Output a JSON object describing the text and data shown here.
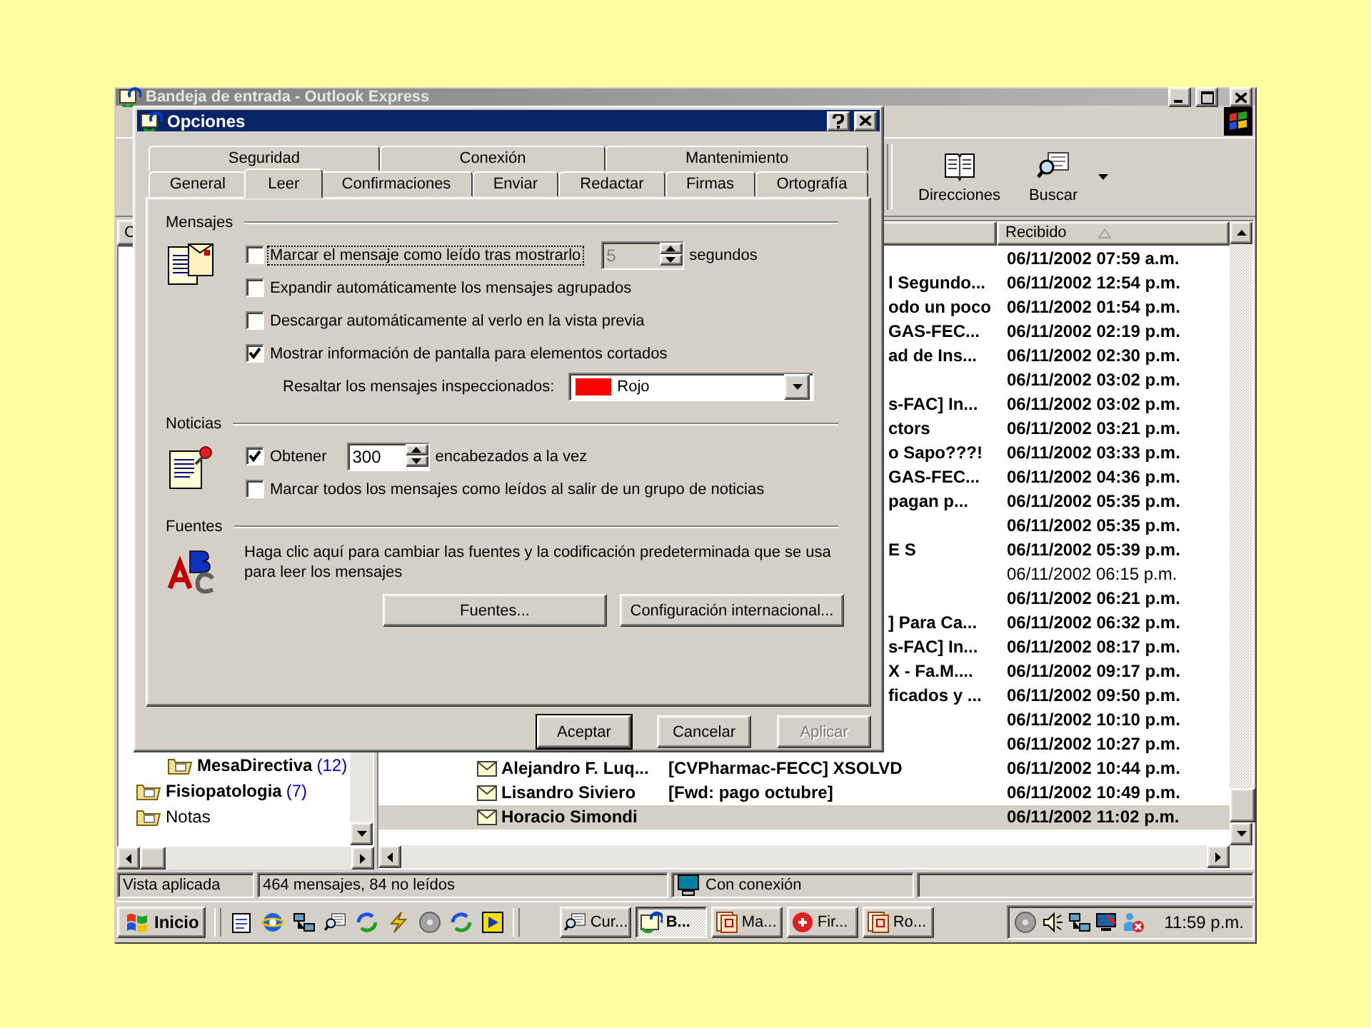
{
  "main_window": {
    "title": "Bandeja de entrada - Outlook Express",
    "toolbar": [
      {
        "label": "Direcciones",
        "kind": "book"
      },
      {
        "label": "Buscar",
        "kind": "search"
      }
    ],
    "folder_pane": {
      "header": "C",
      "folders": [
        {
          "name": "MesaDirectiva",
          "count": "(12)",
          "unread": true,
          "kind": "subfolder"
        },
        {
          "name": "Fisiopatologia",
          "count": "(7)",
          "unread": true,
          "kind": "folder"
        },
        {
          "name": "Notas",
          "unread": false,
          "kind": "folder"
        }
      ]
    },
    "message_list": {
      "columns": [
        {
          "label": "Recibido",
          "sorted": true
        }
      ],
      "rows": [
        {
          "received": "06/11/2002 07:59 a.m.",
          "unread": true,
          "selected": false
        },
        {
          "subject": "l Segundo...",
          "received": "06/11/2002 12:54 p.m.",
          "unread": true,
          "selected": false
        },
        {
          "subject": "odo un poco",
          "received": "06/11/2002 01:54 p.m.",
          "unread": true,
          "selected": false
        },
        {
          "subject": "GAS-FEC...",
          "received": "06/11/2002 02:19 p.m.",
          "unread": true,
          "selected": false
        },
        {
          "subject": "ad de Ins...",
          "received": "06/11/2002 02:30 p.m.",
          "unread": true,
          "selected": false
        },
        {
          "received": "06/11/2002 03:02 p.m.",
          "unread": true,
          "selected": false
        },
        {
          "subject": "s-FAC] In...",
          "received": "06/11/2002 03:02 p.m.",
          "unread": true,
          "selected": false
        },
        {
          "subject": "ctors",
          "received": "06/11/2002 03:21 p.m.",
          "unread": true,
          "selected": false
        },
        {
          "subject": "o Sapo???!",
          "received": "06/11/2002 03:33 p.m.",
          "unread": true,
          "selected": false
        },
        {
          "subject": "GAS-FEC...",
          "received": "06/11/2002 04:36 p.m.",
          "unread": true,
          "selected": false
        },
        {
          "subject": "pagan p...",
          "received": "06/11/2002 05:35 p.m.",
          "unread": true,
          "selected": false
        },
        {
          "received": "06/11/2002 05:35 p.m.",
          "unread": true,
          "selected": false
        },
        {
          "subject": "E S",
          "received": "06/11/2002 05:39 p.m.",
          "unread": true,
          "selected": false
        },
        {
          "received": "06/11/2002 06:15 p.m.",
          "unread": false,
          "selected": false
        },
        {
          "received": "06/11/2002 06:21 p.m.",
          "unread": true,
          "selected": false
        },
        {
          "subject": "] Para Ca...",
          "received": "06/11/2002 06:32 p.m.",
          "unread": true,
          "selected": false
        },
        {
          "subject": "s-FAC] In...",
          "received": "06/11/2002 08:17 p.m.",
          "unread": true,
          "selected": false
        },
        {
          "subject": "X - Fa.M....",
          "received": "06/11/2002 09:17 p.m.",
          "unread": true,
          "selected": false
        },
        {
          "subject": "ficados y ...",
          "received": "06/11/2002 09:50 p.m.",
          "unread": true,
          "selected": false
        },
        {
          "received": "06/11/2002 10:10 p.m.",
          "unread": true,
          "selected": false
        },
        {
          "received": "06/11/2002 10:27 p.m.",
          "unread": true,
          "selected": false
        },
        {
          "from": "Alejandro F. Luq...",
          "subject": "[CVPharmac-FECC] XSOLVD",
          "received": "06/11/2002 10:44 p.m.",
          "unread": true,
          "selected": false
        },
        {
          "from": "Lisandro Siviero",
          "subject": "[Fwd: pago octubre]",
          "received": "06/11/2002 10:49 p.m.",
          "unread": true,
          "selected": false
        },
        {
          "from": "Horacio Simondi",
          "received": "06/11/2002 11:02 p.m.",
          "unread": true,
          "selected": true
        }
      ]
    },
    "status_bar": [
      {
        "text": "Vista aplicada",
        "kind": "text"
      },
      {
        "text": "464 mensajes, 84 no leídos",
        "kind": "text"
      },
      {
        "text": "Con conexión",
        "kind": "connection"
      }
    ]
  },
  "dialog": {
    "title": "Opciones",
    "tab_rows": [
      [
        {
          "label": "Seguridad",
          "selected": false
        },
        {
          "label": "Conexión",
          "selected": false
        },
        {
          "label": "Mantenimiento",
          "selected": false
        }
      ],
      [
        {
          "label": "General",
          "selected": false
        },
        {
          "label": "Leer",
          "selected": true
        },
        {
          "label": "Confirmaciones",
          "selected": false
        },
        {
          "label": "Enviar",
          "selected": false
        },
        {
          "label": "Redactar",
          "selected": false
        },
        {
          "label": "Firmas",
          "selected": false
        },
        {
          "label": "Ortografía",
          "selected": false
        }
      ]
    ],
    "sections": [
      {
        "title": "Mensajes",
        "kind": "messages",
        "options": [
          {
            "kind": "checkbox",
            "label": "Marcar el mensaje como leído tras mostrarlo",
            "checked": false,
            "focused": true,
            "spinner": {
              "value": "5",
              "disabled": true
            },
            "suffix": "segundos"
          },
          {
            "kind": "checkbox",
            "label": "Expandir automáticamente los mensajes agrupados",
            "checked": false,
            "focused": false
          },
          {
            "kind": "checkbox",
            "label": "Descargar automáticamente al verlo en la vista previa",
            "checked": false,
            "focused": false
          },
          {
            "kind": "checkbox",
            "label": "Mostrar información de pantalla para elementos cortados",
            "checked": true,
            "focused": false
          },
          {
            "kind": "dropdown",
            "label": "Resaltar los mensajes inspeccionados:",
            "value": "Rojo",
            "color": "#ff0000"
          }
        ]
      },
      {
        "title": "Noticias",
        "kind": "news",
        "options": [
          {
            "kind": "checkbox",
            "label": "Obtener",
            "checked": true,
            "focused": false,
            "spinner": {
              "value": "300",
              "disabled": false
            },
            "suffix": "encabezados a la vez"
          },
          {
            "kind": "checkbox",
            "label": "Marcar todos los mensajes como leídos al salir de un grupo de noticias",
            "checked": false,
            "focused": false
          }
        ]
      },
      {
        "title": "Fuentes",
        "kind": "fonts",
        "text": "Haga clic aquí para cambiar las fuentes y la codificación predeterminada que se usa para leer los mensajes",
        "buttons": [
          "Fuentes...",
          "Configuración internacional..."
        ]
      }
    ],
    "buttons": [
      {
        "label": "Aceptar",
        "default": true,
        "disabled": false
      },
      {
        "label": "Cancelar",
        "default": false,
        "disabled": false
      },
      {
        "label": "Aplicar",
        "default": false,
        "disabled": true
      }
    ]
  },
  "taskbar": {
    "start": "Inicio",
    "tasks": [
      {
        "label": "Cur...",
        "kind": "search",
        "selected": false
      },
      {
        "label": "B...",
        "kind": "mail",
        "selected": true
      },
      {
        "label": "Ma...",
        "kind": "document",
        "selected": false
      },
      {
        "label": "Fir...",
        "kind": "red",
        "selected": false
      },
      {
        "label": "Ro...",
        "kind": "document",
        "selected": false
      }
    ],
    "clock": "11:59 p.m."
  }
}
